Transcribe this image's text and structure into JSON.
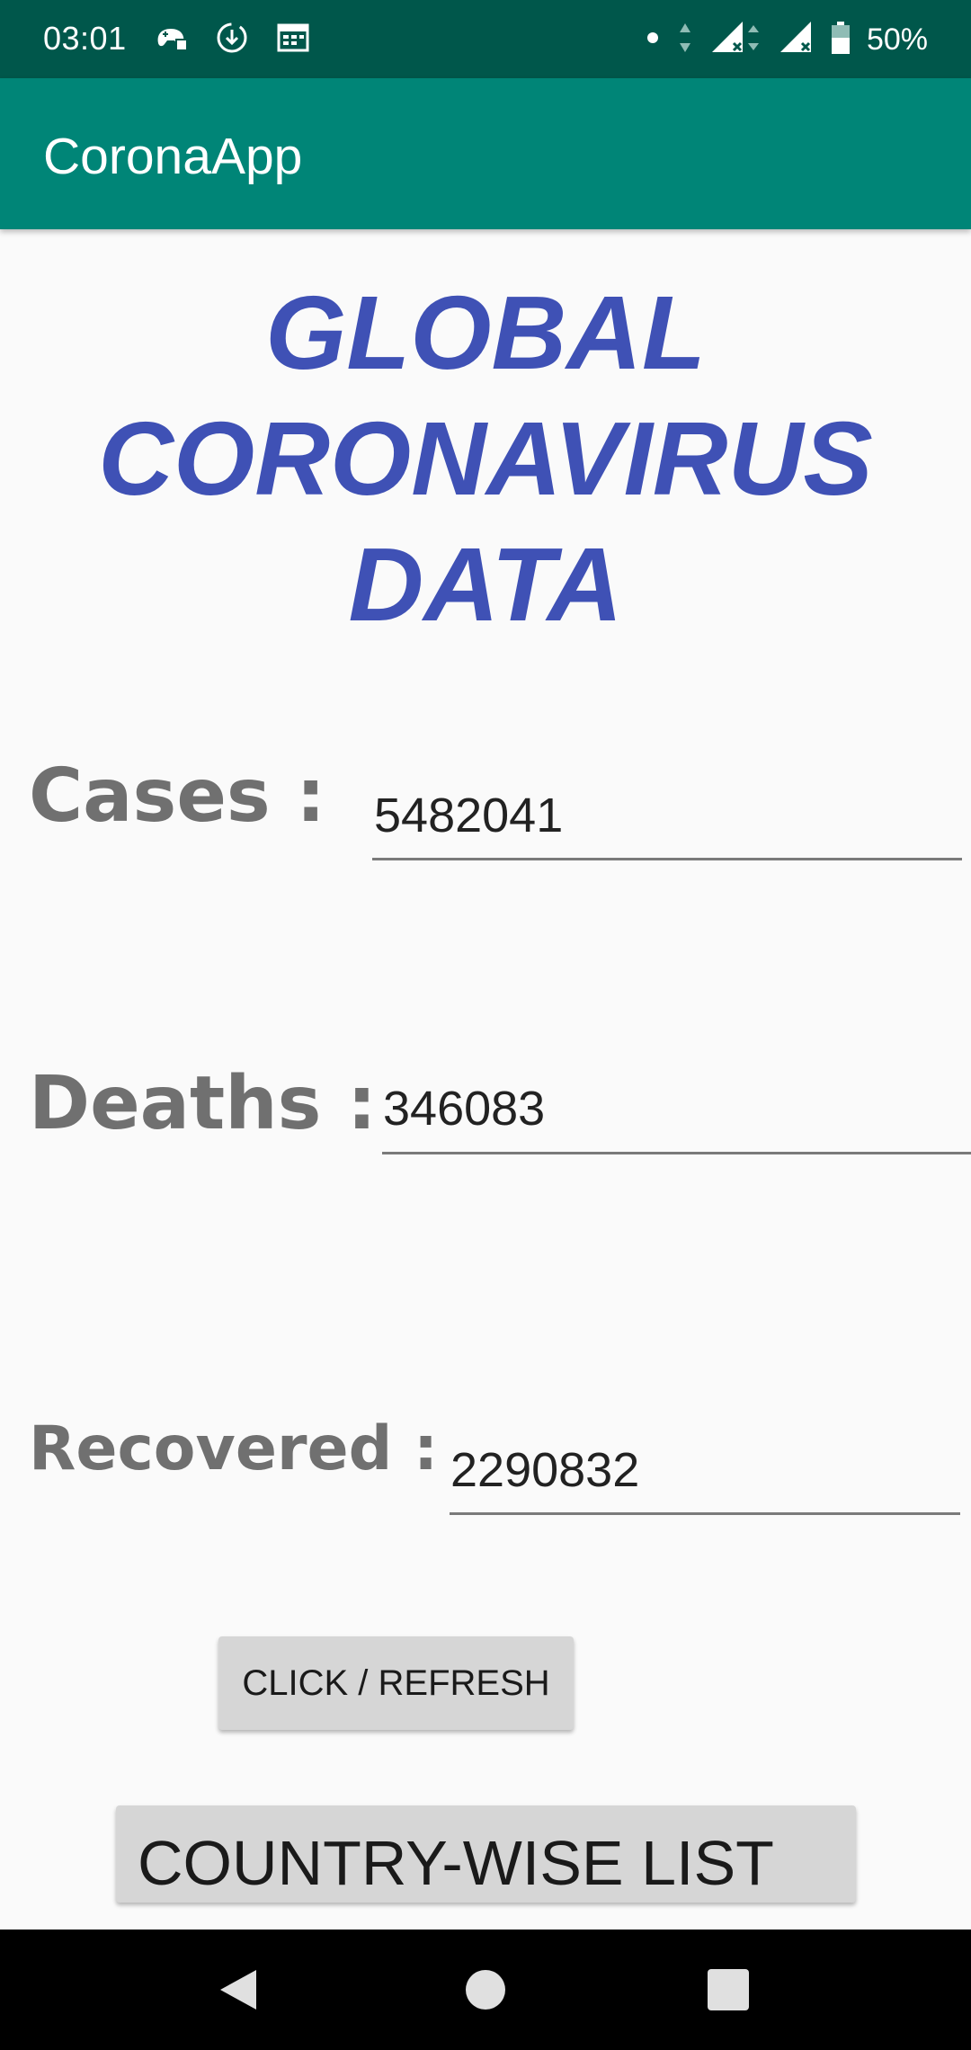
{
  "status_bar": {
    "time": "03:01",
    "battery": "50%",
    "left_icons": [
      "game-controller-icon",
      "download-sync-icon",
      "calendar-icon"
    ],
    "right_icons": [
      "dot-icon",
      "data-arrows-icon",
      "signal-icon",
      "signal-icon",
      "battery-icon"
    ]
  },
  "app_bar": {
    "title": "CoronaApp"
  },
  "headline": {
    "line1": "GLOBAL",
    "line2": "CORONAVIRUS",
    "line3": "DATA"
  },
  "stats": {
    "cases_label": "Cases :",
    "cases_value": "5482041",
    "deaths_label": "Deaths :",
    "deaths_value": "346083",
    "recovered_label": "Recovered :",
    "recovered_value": "2290832"
  },
  "buttons": {
    "refresh": "CLICK / REFRESH",
    "country_list": "COUNTRY-WISE LIST"
  },
  "nav_bar": {
    "icons": [
      "back-icon",
      "home-icon",
      "recents-icon"
    ]
  },
  "colors": {
    "status_bar": "#00574b",
    "app_bar": "#008577",
    "headline": "#3f51b5",
    "label": "#707070",
    "button": "#d6d6d6"
  }
}
